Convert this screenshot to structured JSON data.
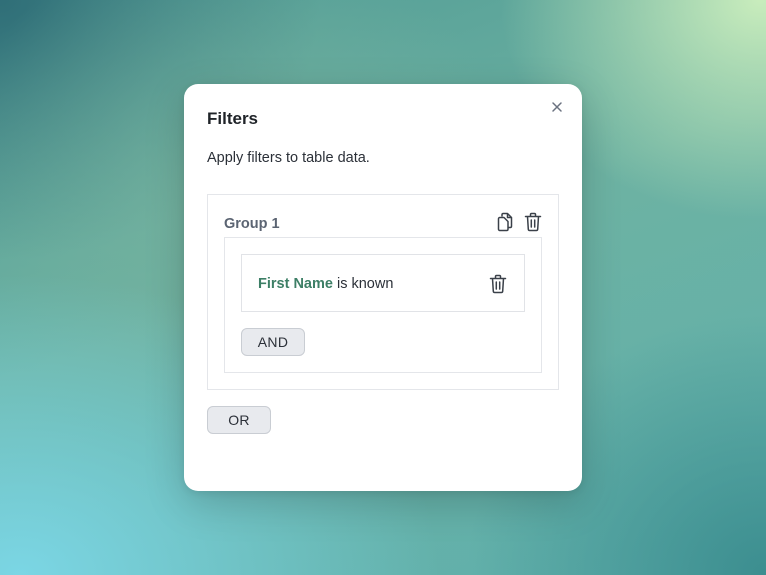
{
  "dialog": {
    "title": "Filters",
    "description": "Apply filters to table data.",
    "close_icon": "close-icon"
  },
  "group": {
    "title": "Group 1",
    "copy_icon": "copy-icon",
    "delete_icon": "trash-icon",
    "condition": {
      "field": "First Name",
      "operator": "is known",
      "delete_icon": "trash-icon"
    },
    "and_label": "AND"
  },
  "or_label": "OR",
  "colors": {
    "field_accent": "#3d7f66",
    "button_bg": "#e8eaee",
    "border": "#e4e6ea"
  }
}
